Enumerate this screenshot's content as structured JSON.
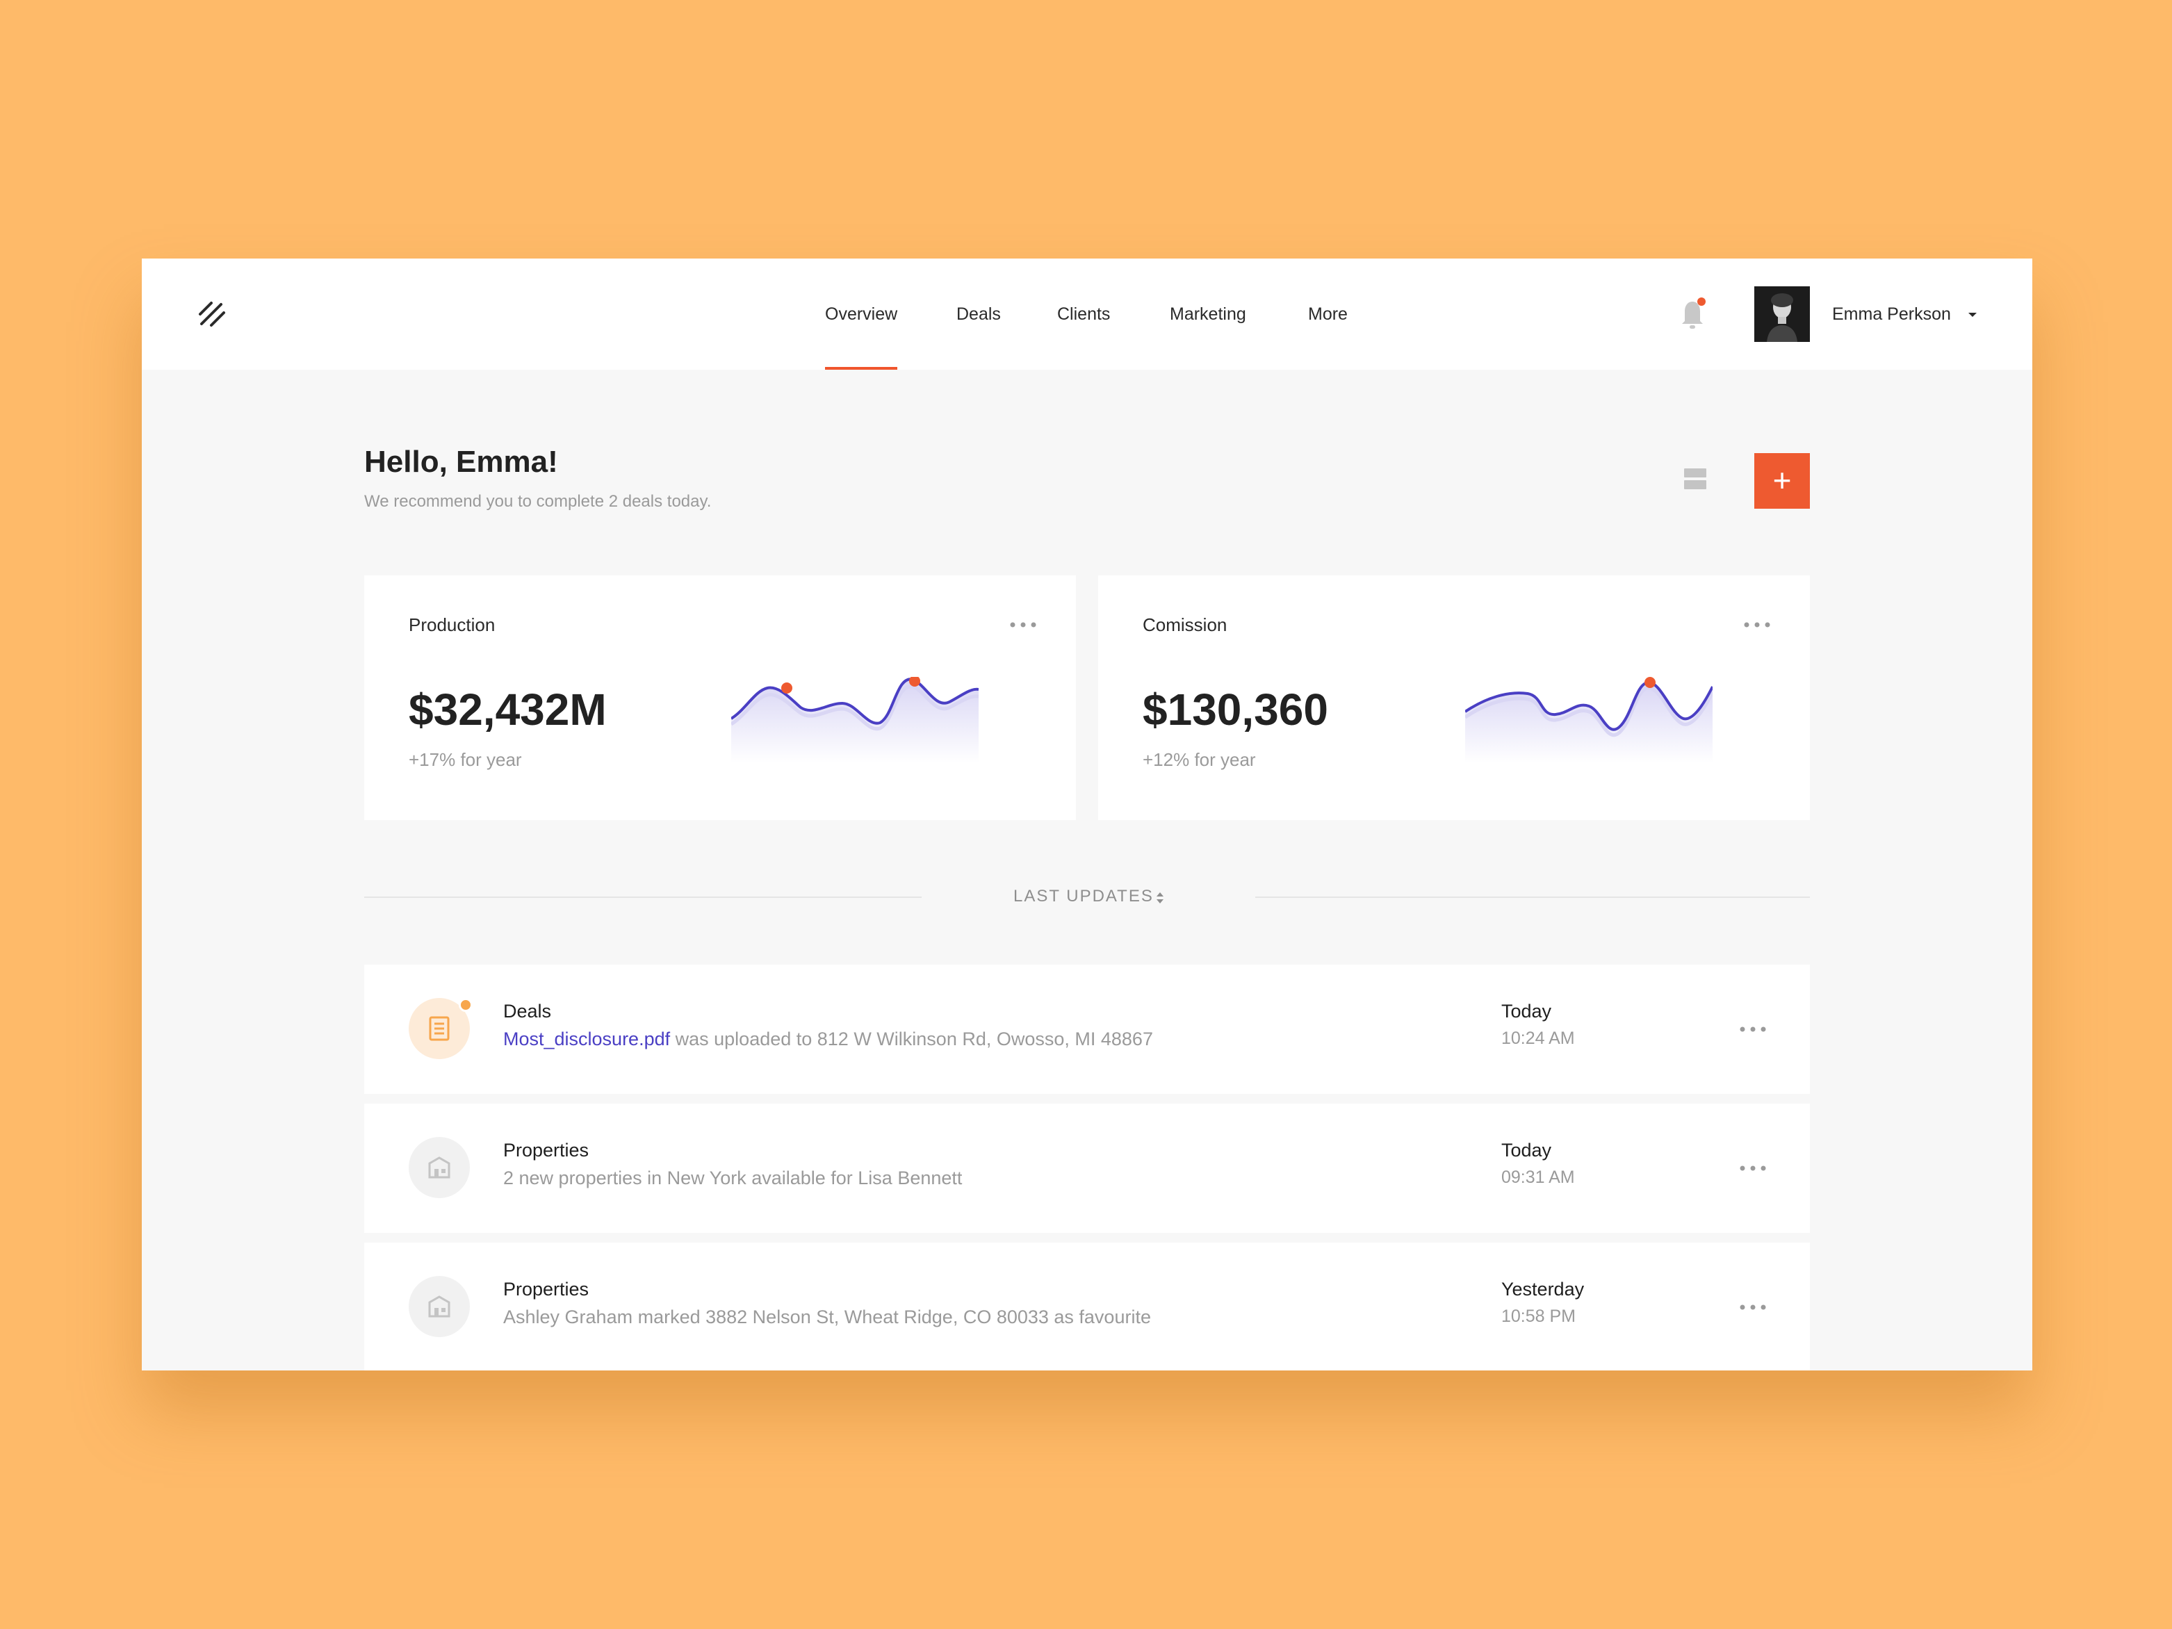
{
  "header": {
    "logo": "logo-slash-icon",
    "nav": [
      {
        "label": "Overview",
        "active": true
      },
      {
        "label": "Deals",
        "active": false
      },
      {
        "label": "Clients",
        "active": false
      },
      {
        "label": "Marketing",
        "active": false
      },
      {
        "label": "More",
        "active": false
      }
    ],
    "notifications": {
      "icon": "bell-icon",
      "has_unread": true
    },
    "user": {
      "name": "Emma Perkson",
      "avatar": "user-avatar",
      "menu_icon": "caret-down-icon"
    }
  },
  "hero": {
    "greeting": "Hello, Emma!",
    "subtext": "We recommend you to complete 2 deals today.",
    "view_toggle_icon": "layout-rows-icon",
    "add_button_label": "+"
  },
  "cards": [
    {
      "title": "Production",
      "value": "$32,432M",
      "delta": "+17% for year",
      "menu_icon": "more-dots-icon"
    },
    {
      "title": "Comission",
      "value": "$130,360",
      "delta": "+12% for year",
      "menu_icon": "more-dots-icon"
    }
  ],
  "updates": {
    "label": "LAST UPDATES",
    "sort_icon": "sort-updown-icon",
    "items": [
      {
        "icon": "document-icon",
        "category": "Deals",
        "link": "Most_disclosure.pdf",
        "text": " was uploaded to 812 W Wilkinson Rd, Owosso, MI 48867",
        "day": "Today",
        "time": "10:24 AM",
        "unread": true
      },
      {
        "icon": "building-icon",
        "category": "Properties",
        "link": "",
        "text": "2 new properties in New York available for Lisa Bennett",
        "day": "Today",
        "time": "09:31 AM",
        "unread": false
      },
      {
        "icon": "building-icon",
        "category": "Properties",
        "link": "",
        "text": "Ashley Graham marked 3882 Nelson St, Wheat Ridge, CO 80033 as favourite",
        "day": "Yesterday",
        "time": "10:58 PM",
        "unread": false
      }
    ]
  },
  "colors": {
    "background": "#FEBA69",
    "accent": "#EE5A30",
    "chart_line": "#4A3FC4",
    "link": "#4A3FC4"
  }
}
